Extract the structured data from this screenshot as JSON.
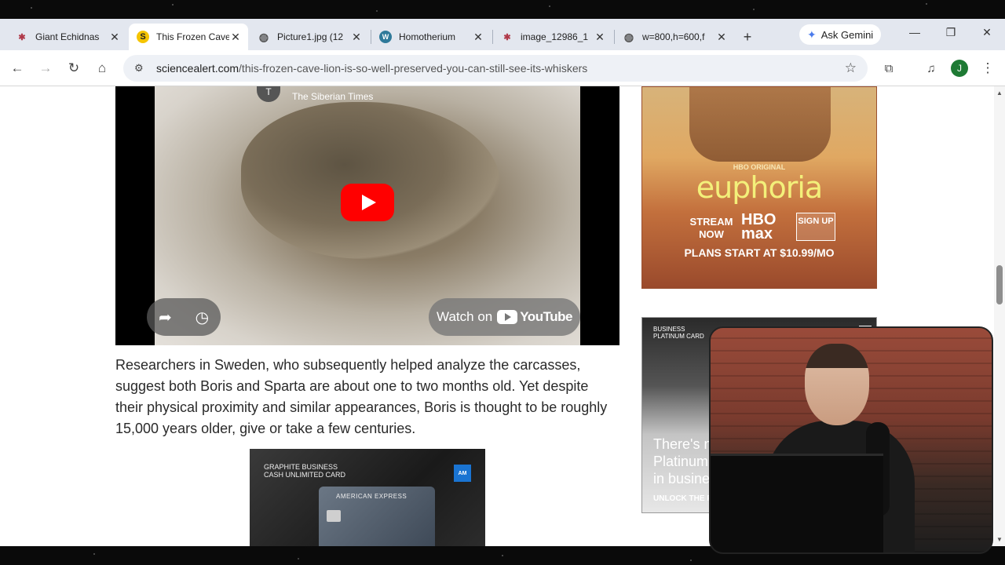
{
  "tabs": [
    {
      "title": "Giant Echidnas",
      "favicon": "site-star-icon",
      "active": false
    },
    {
      "title": "This Frozen Cave",
      "favicon": "sciencealert-icon",
      "active": true
    },
    {
      "title": "Picture1.jpg (12",
      "favicon": "globe-icon",
      "active": false
    },
    {
      "title": "Homotherium",
      "favicon": "wiki-icon",
      "active": false
    },
    {
      "title": "image_12986_1",
      "favicon": "site-star-icon",
      "active": false
    },
    {
      "title": "w=800,h=600,f",
      "favicon": "globe-icon",
      "active": false
    }
  ],
  "gemini_label": "Ask Gemini",
  "address": {
    "host": "sciencealert.com",
    "path": "/this-frozen-cave-lion-is-so-well-preserved-you-can-still-see-its-whiskers"
  },
  "profile_initial": "J",
  "video": {
    "channel": "The Siberian Times",
    "channel_initial": "T",
    "watch_on": "Watch on",
    "youtube": "YouTube"
  },
  "article_paragraph": "Researchers in Sweden, who subsequently helped analyze the carcasses, suggest both Boris and Sparta are about one to two months old. Yet despite their physical proximity and similar appearances, Boris is thought to be roughly 15,000 years older, give or take a few centuries.",
  "ad_amex_bottom": {
    "label_line1": "GRAPHITE BUSINESS",
    "label_line2": "CASH UNLIMITED CARD",
    "card_title": "AMERICAN EXPRESS"
  },
  "ad_euphoria": {
    "hbo_original": "HBO ORIGINAL",
    "title": "euphoria",
    "stream_now": "STREAM NOW",
    "hbomax": "HBO max",
    "signup": "SIGN UP",
    "plans": "PLANS START AT $10.99/MO"
  },
  "ad_amex_side": {
    "label_line1": "BUSINESS",
    "label_line2": "PLATINUM CARD",
    "headline_line1": "There's n",
    "headline_line2": "Platinum",
    "headline_line3": "in busines",
    "cta": "UNLOCK THE P"
  },
  "colors": {
    "tabstrip": "#e3e7ef",
    "youtube_red": "#ff0000",
    "amex_blue": "#1a74d2",
    "euphoria_yellow": "#f3f07a"
  }
}
